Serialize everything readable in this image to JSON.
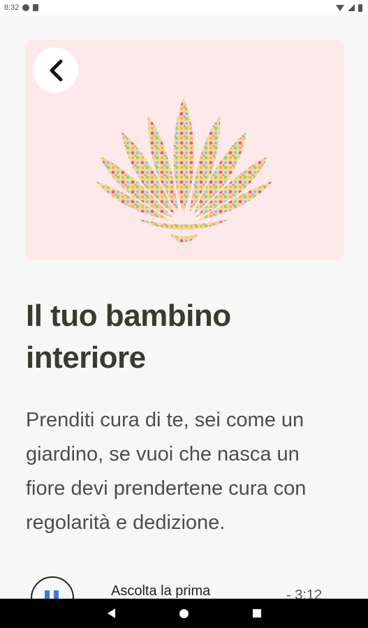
{
  "status_bar": {
    "time": "8:32",
    "icons": [
      "data-saver-icon",
      "sim-icon",
      "wifi-icon",
      "signal-icon",
      "battery-icon"
    ]
  },
  "hero": {
    "background_color": "#fde8ea",
    "back_icon": "chevron-left-icon",
    "image": "lotus-mosaic-illustration"
  },
  "content": {
    "title": "Il tuo bambino interiore",
    "description": "Prenditi cura di te, sei come un giardino, se vuoi che nasca un fiore devi prendertene cura con regolarità e dedizione."
  },
  "player": {
    "state_icon": "pause-icon",
    "track_label": "Ascolta la prima",
    "remaining_time": "- 3:12",
    "accent_color": "#3e7bd6"
  },
  "nav_bar": {
    "icons": [
      "nav-back-icon",
      "nav-home-icon",
      "nav-recents-icon"
    ]
  }
}
